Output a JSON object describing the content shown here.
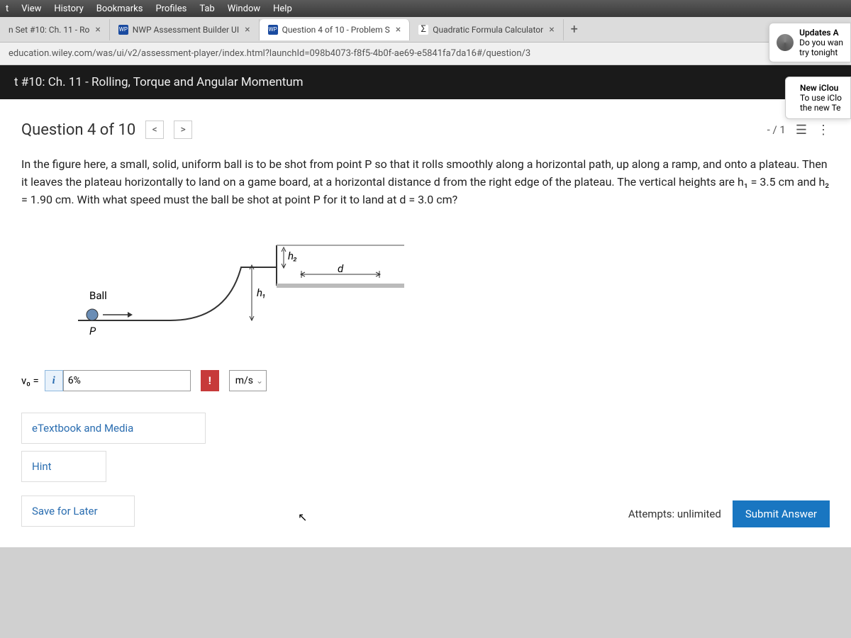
{
  "menubar": {
    "items": [
      "t",
      "View",
      "History",
      "Bookmarks",
      "Profiles",
      "Tab",
      "Window",
      "Help"
    ]
  },
  "tabs": {
    "t0": {
      "label": "n Set #10: Ch. 11 - Ro"
    },
    "t1": {
      "label": "NWP Assessment Builder UI",
      "fav": "WP"
    },
    "t2": {
      "label": "Question 4 of 10 - Problem S",
      "fav": "WP"
    },
    "t3": {
      "label": "Quadratic Formula Calculator",
      "fav": "Σ"
    },
    "new": "+"
  },
  "notif1": {
    "line1": "Updates A",
    "line2": "Do you wan",
    "line3": "try tonight"
  },
  "url": "education.wiley.com/was/ui/v2/assessment-player/index.html?launchId=098b4073-f8f5-4b0f-ae69-e5841fa7da16#/question/3",
  "pageheader": {
    "title": "t #10: Ch. 11 - Rolling, Torque and Angular Momentum"
  },
  "notif2": {
    "line1": "New iClou",
    "line2": "To use iClo",
    "line3": "the new Te"
  },
  "question": {
    "title": "Question 4 of 10",
    "prev": "<",
    "next": ">",
    "score": "- / 1",
    "text": "In the figure here, a small, solid, uniform ball is to be shot from point P so that it rolls smoothly along a horizontal path, up along a ramp, and onto a plateau. Then it leaves the plateau horizontally to land on a game board, at a horizontal distance d from the right edge of the plateau. The vertical heights are h₁ = 3.5 cm and h₂ = 1.90 cm. With what speed must the ball be shot at point P for it to land at d = 3.0 cm?"
  },
  "fig": {
    "ball": "Ball",
    "P": "P",
    "h1": "h₁",
    "h2": "h₂",
    "d": "d"
  },
  "answer": {
    "label": "v₀ =",
    "value": "6%",
    "unit": "m/s",
    "err": "!"
  },
  "links": {
    "etext": "eTextbook and Media",
    "hint": "Hint",
    "save": "Save for Later"
  },
  "footer": {
    "attempts": "Attempts: unlimited",
    "submit": "Submit Answer"
  }
}
